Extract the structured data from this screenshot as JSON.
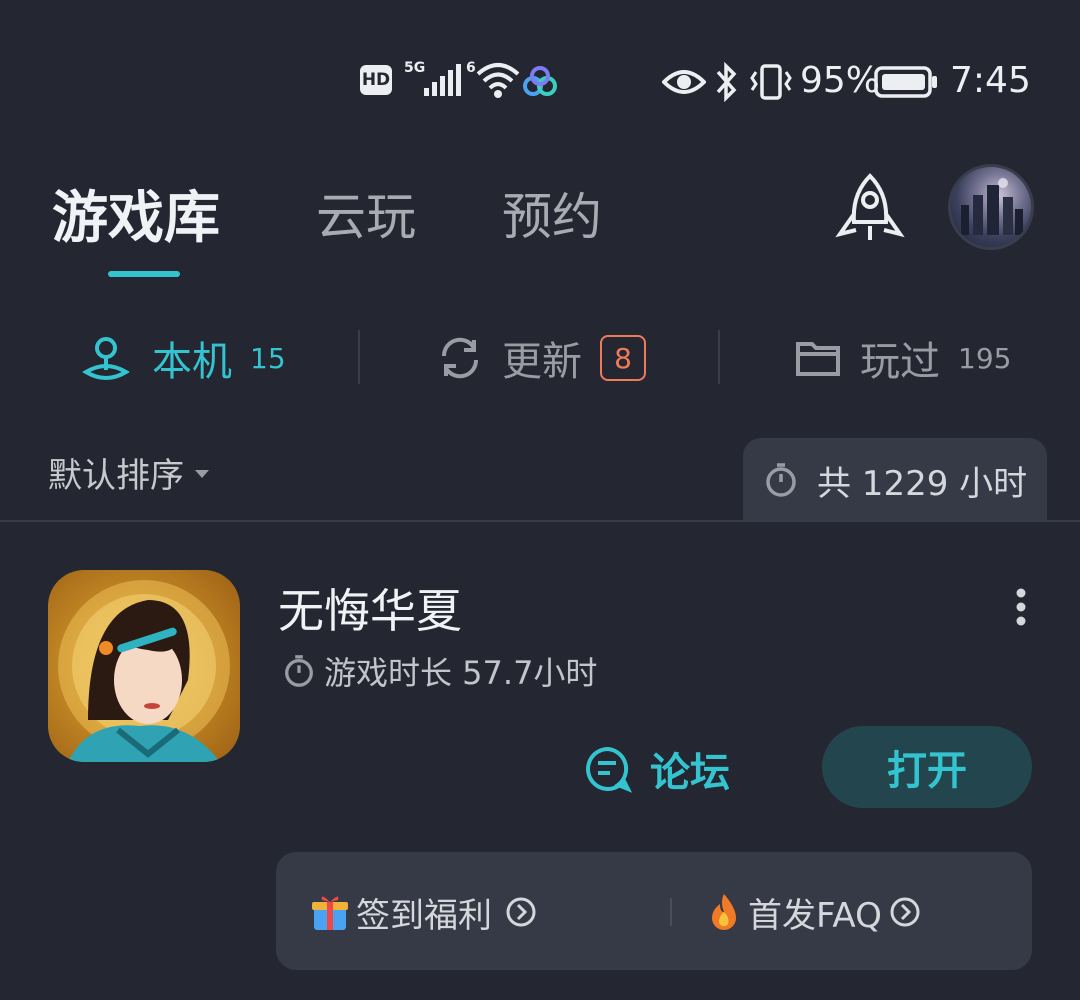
{
  "status_bar": {
    "hd": "HD",
    "signal_5g": "5G",
    "signal_6": "6",
    "battery_percent": "95%",
    "time": "7:45"
  },
  "top_tabs": [
    {
      "label": "游戏库",
      "active": true
    },
    {
      "label": "云玩",
      "active": false
    },
    {
      "label": "预约",
      "active": false
    }
  ],
  "sub_tabs": [
    {
      "label": "本机",
      "count": "15",
      "icon": "local-device-icon",
      "active": true
    },
    {
      "label": "更新",
      "count": "8",
      "icon": "refresh-icon",
      "active": false
    },
    {
      "label": "玩过",
      "count": "195",
      "icon": "folder-icon",
      "active": false
    }
  ],
  "sort": {
    "label": "默认排序"
  },
  "total_time": {
    "label": "共 1229 小时"
  },
  "game": {
    "title": "无悔华夏",
    "play_time": "游戏时长 57.7小时",
    "forum_label": "论坛",
    "open_label": "打开",
    "promos": [
      {
        "label": "签到福利",
        "icon": "gift-icon"
      },
      {
        "label": "首发FAQ",
        "icon": "fire-icon"
      }
    ]
  },
  "colors": {
    "accent": "#33c4cf",
    "badge": "#ee7b58",
    "background": "#242631"
  }
}
